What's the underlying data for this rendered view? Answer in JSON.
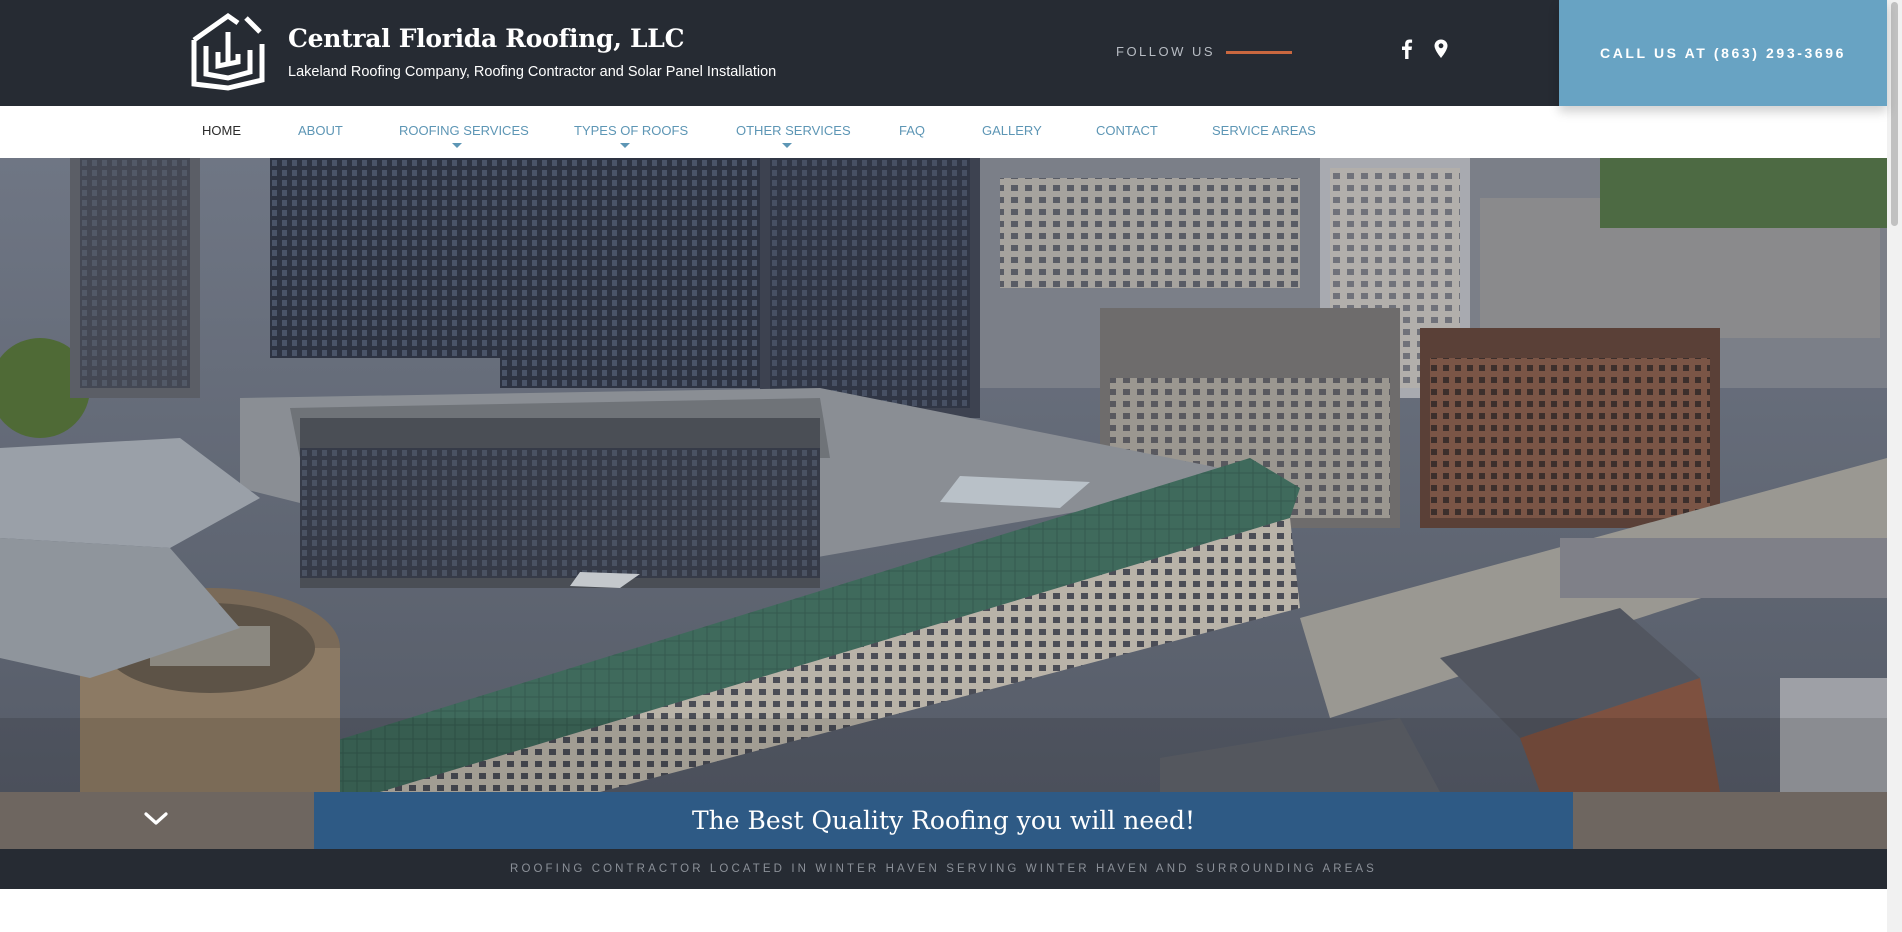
{
  "header": {
    "brand_title": "Central Florida Roofing, LLC",
    "brand_subtitle": "Lakeland Roofing Company, Roofing Contractor and Solar Panel Installation",
    "follow_label": "FOLLOW US",
    "social_icons": [
      "facebook-icon",
      "map-pin-icon"
    ],
    "call_label": "CALL US AT (863) 293-3696",
    "accent_color": "#c9673f",
    "call_bg_color": "#68a3c3"
  },
  "nav": {
    "items": [
      {
        "label": "HOME",
        "active": true,
        "dropdown": false
      },
      {
        "label": "ABOUT",
        "active": false,
        "dropdown": false
      },
      {
        "label": "ROOFING SERVICES",
        "active": false,
        "dropdown": true
      },
      {
        "label": "TYPES OF ROOFS",
        "active": false,
        "dropdown": true
      },
      {
        "label": "OTHER SERVICES",
        "active": false,
        "dropdown": true
      },
      {
        "label": "FAQ",
        "active": false,
        "dropdown": false
      },
      {
        "label": "GALLERY",
        "active": false,
        "dropdown": false
      },
      {
        "label": "CONTACT",
        "active": false,
        "dropdown": false
      },
      {
        "label": "SERVICE AREAS",
        "active": false,
        "dropdown": false
      }
    ]
  },
  "hero": {
    "image": "aerial-city-rooftops-photo",
    "banner_text": "The Best Quality Roofing you will need!",
    "banner_color": "#2e5a85",
    "scroll_icon": "chevron-down-icon",
    "tagline": "ROOFING CONTRACTOR LOCATED IN WINTER HAVEN SERVING WINTER HAVEN AND SURROUNDING AREAS"
  }
}
